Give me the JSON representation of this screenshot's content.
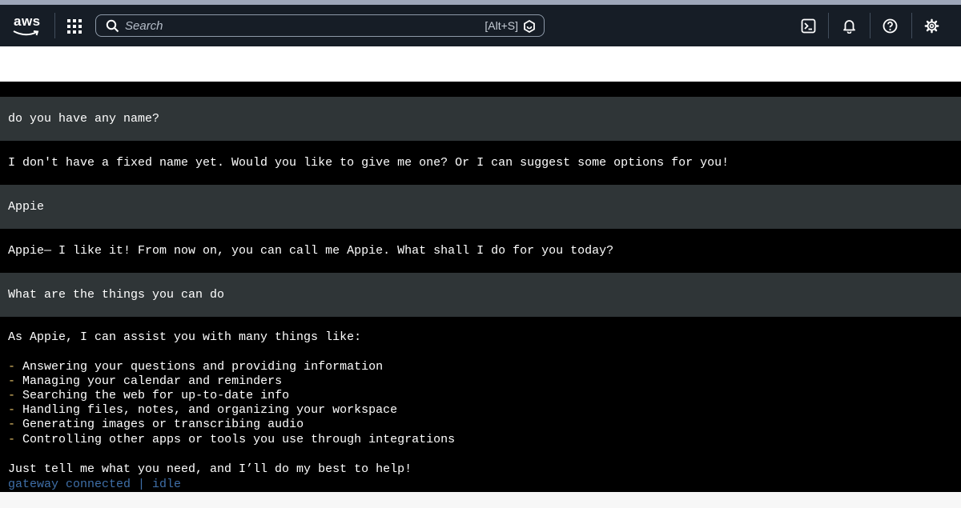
{
  "nav": {
    "logo_text": "aws",
    "search_placeholder": "Search",
    "search_shortcut": "[Alt+S]"
  },
  "chat": {
    "messages": [
      {
        "role": "user",
        "text": "do you have any name?"
      },
      {
        "role": "assistant",
        "text": "I don't have a fixed name yet. Would you like to give me one? Or I can suggest some options for you!"
      },
      {
        "role": "user",
        "text": "Appie"
      },
      {
        "role": "assistant",
        "text": "Appie— I like it! From now on, you can call me Appie. What shall I do for you today?"
      },
      {
        "role": "user",
        "text": "What are the things you can do"
      }
    ],
    "final_reply": {
      "intro": "As Appie, I can assist you with many things like:",
      "bullet_marker": "-",
      "items": [
        "Answering your questions and providing information",
        "Managing your calendar and reminders",
        "Searching the web for up-to-date info",
        "Handling files, notes, and organizing your workspace",
        "Generating images or transcribing audio",
        "Controlling other apps or tools you use through integrations"
      ],
      "closing": "Just tell me what you need, and I’ll do my best to help!"
    },
    "status": "gateway connected | idle"
  },
  "colors": {
    "nav_bg": "#161d26",
    "user_row_bg": "#2f3537",
    "terminal_bg": "#000000",
    "bullet": "#e7c36a",
    "status": "#3f6fa8"
  }
}
